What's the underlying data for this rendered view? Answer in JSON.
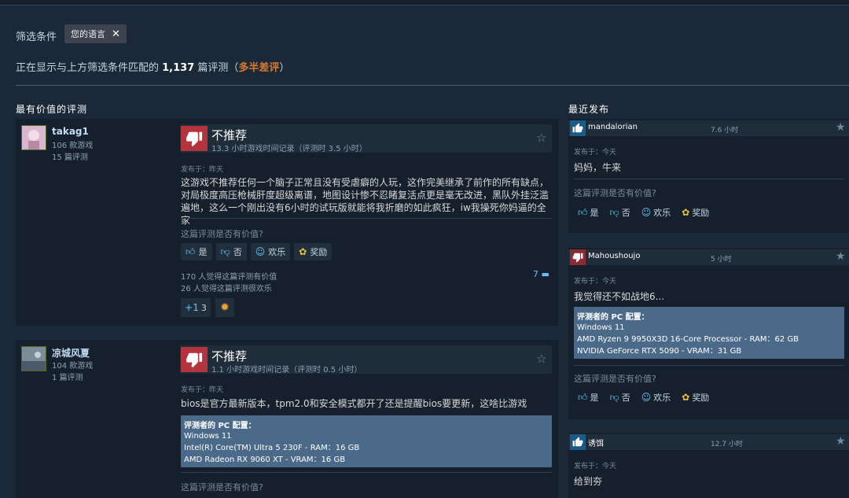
{
  "filters": {
    "label": "筛选条件",
    "chip": "您的语言",
    "summary_prefix": "正在显示与上方筛选条件匹配的 ",
    "summary_count": "1,137",
    "summary_mid": " 篇评测（",
    "summary_rating": "多半差评",
    "summary_suffix": "）"
  },
  "sections": {
    "helpful": "最有价值的评测",
    "recent": "最近发布"
  },
  "buttons": {
    "yes": "是",
    "no": "否",
    "funny": "欢乐",
    "award": "奖励"
  },
  "helpful_question": "这篇评测是否有价值?",
  "spec_title": "评测者的 PC 配置：",
  "reviews": [
    {
      "user": "takag1",
      "products": "106 款游戏",
      "reviews_count": "15 篇评测",
      "verdict": "不推荐",
      "hours": "13.3 小时游戏时间记录（评测时 3.5 小时）",
      "posted": "发布于：昨天",
      "text": "这游戏不推荐任何一个脑子正常且没有受虐癖的人玩，这作完美继承了前作的所有缺点，对局极度高压枪械肝度超级离谱，地图设计惨不忍睹复活点更是毫无改进，黑队外挂泛滥遍地，这么一个刚出没有6小时的试玩版就能将我折磨的如此疯狂，iw我操死你妈逼的全家",
      "helpful_stat": "170 人觉得这篇评测有价值",
      "funny_stat": "26 人觉得这篇评测很欢乐",
      "comments": "7",
      "award_count": "3"
    },
    {
      "user": "凉城风夏",
      "products": "104 款游戏",
      "reviews_count": "1 篇评测",
      "verdict": "不推荐",
      "hours": "1.1 小时游戏时间记录（评测时 0.5 小时）",
      "posted": "发布于：昨天",
      "text": "bios是官方最新版本，tpm2.0和安全模式都开了还是提醒bios要更新，这啥比游戏",
      "spec": [
        "Windows 11",
        "Intel(R) Core(TM) Ultra 5 230F - RAM：16 GB",
        "AMD Radeon RX 9060 XT - VRAM：16 GB"
      ]
    }
  ],
  "recent": [
    {
      "user": "mandalorian",
      "hours": "7.6 小时",
      "posted": "发布于：今天",
      "text": "妈妈，牛来",
      "thumb": "up"
    },
    {
      "user": "Mahoushoujo",
      "hours": "5 小时",
      "posted": "发布于：今天",
      "text": "我觉得还不如战地6...",
      "thumb": "down",
      "spec": [
        "Windows 11",
        "AMD Ryzen 9 9950X3D 16-Core Processor - RAM：62 GB",
        "NVIDIA GeForce RTX 5090 - VRAM：31 GB"
      ]
    },
    {
      "user": "诱饵",
      "hours": "12.7 小时",
      "posted": "发布于：今天",
      "text": "给到夯",
      "thumb": "up"
    }
  ]
}
